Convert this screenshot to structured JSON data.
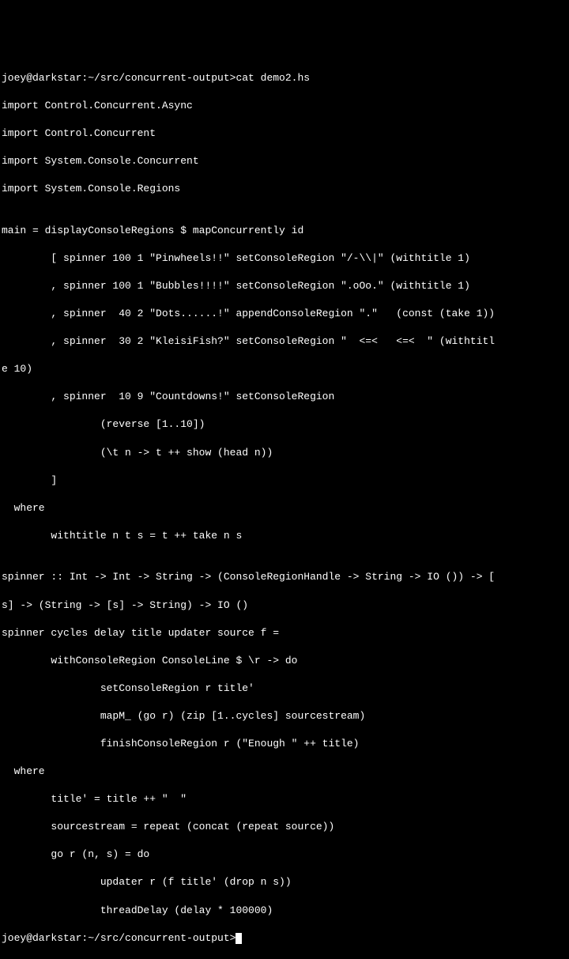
{
  "terminal": {
    "prompt1": "joey@darkstar:~/src/concurrent-output>cat demo2.hs",
    "lines": [
      "import Control.Concurrent.Async",
      "import Control.Concurrent",
      "import System.Console.Concurrent",
      "import System.Console.Regions",
      "",
      "main = displayConsoleRegions $ mapConcurrently id",
      "        [ spinner 100 1 \"Pinwheels!!\" setConsoleRegion \"/-\\\\|\" (withtitle 1)",
      "        , spinner 100 1 \"Bubbles!!!!\" setConsoleRegion \".oOo.\" (withtitle 1)",
      "        , spinner  40 2 \"Dots......!\" appendConsoleRegion \".\"   (const (take 1))",
      "        , spinner  30 2 \"KleisiFish?\" setConsoleRegion \"  <=<   <=<  \" (withtitl",
      "e 10)",
      "        , spinner  10 9 \"Countdowns!\" setConsoleRegion",
      "                (reverse [1..10])",
      "                (\\t n -> t ++ show (head n))",
      "        ]",
      "  where",
      "        withtitle n t s = t ++ take n s",
      "",
      "spinner :: Int -> Int -> String -> (ConsoleRegionHandle -> String -> IO ()) -> [",
      "s] -> (String -> [s] -> String) -> IO ()",
      "spinner cycles delay title updater source f =",
      "        withConsoleRegion ConsoleLine $ \\r -> do",
      "                setConsoleRegion r title'",
      "                mapM_ (go r) (zip [1..cycles] sourcestream)",
      "                finishConsoleRegion r (\"Enough \" ++ title)",
      "  where",
      "        title' = title ++ \"  \"",
      "        sourcestream = repeat (concat (repeat source))",
      "        go r (n, s) = do",
      "                updater r (f title' (drop n s))",
      "                threadDelay (delay * 100000)"
    ],
    "prompt2": "joey@darkstar:~/src/concurrent-output>"
  }
}
